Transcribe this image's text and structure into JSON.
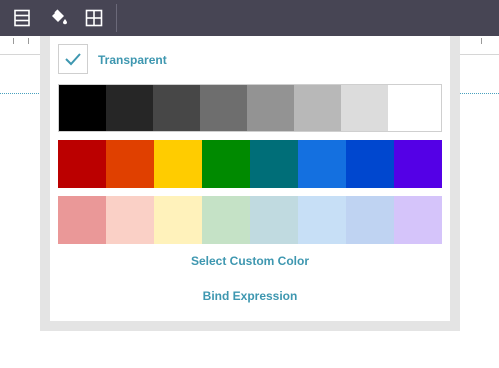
{
  "toolbar": {
    "icons": [
      "table-rows-icon",
      "paint-bucket-icon",
      "grid-icon"
    ]
  },
  "color_picker": {
    "transparent_label": "Transparent",
    "transparent_checked": true,
    "grays": [
      "#000000",
      "#262626",
      "#474747",
      "#6e6e6e",
      "#939393",
      "#b8b8b8",
      "#dcdcdc",
      "#ffffff"
    ],
    "vivid": [
      "#bb0000",
      "#e04000",
      "#ffcc00",
      "#008a00",
      "#006e78",
      "#1470e0",
      "#0047cf",
      "#5400e6"
    ],
    "pastels": [
      "#ea9898",
      "#fad0c6",
      "#fff2bb",
      "#c5e2c6",
      "#c0dae0",
      "#c7dff6",
      "#bfd3f2",
      "#d5c4fa"
    ],
    "select_custom_label": "Select Custom Color",
    "bind_expression_label": "Bind Expression"
  }
}
